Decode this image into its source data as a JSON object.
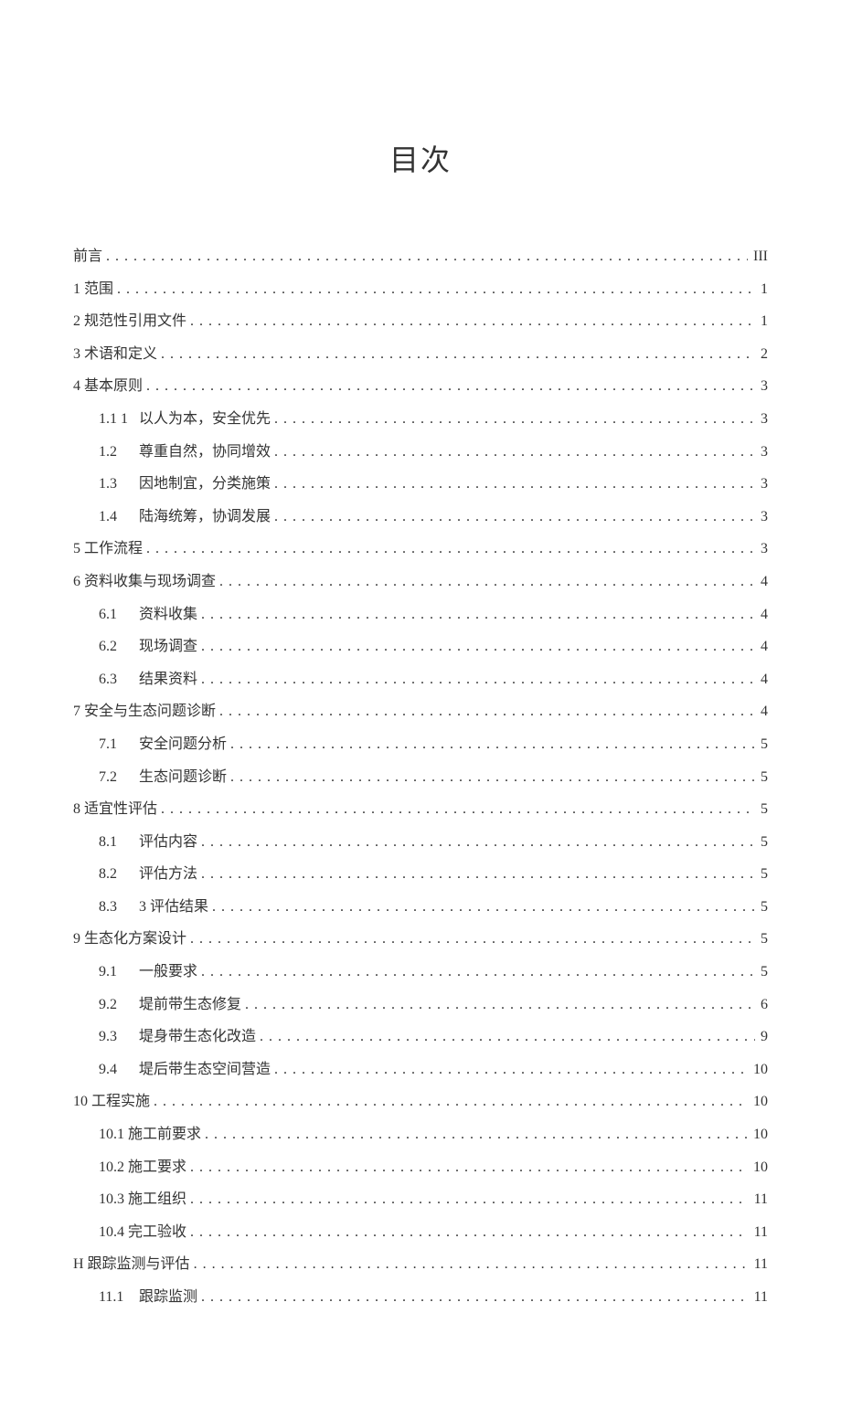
{
  "title": "目次",
  "toc": [
    {
      "indent": 0,
      "num": "",
      "label": "前言",
      "page": "III"
    },
    {
      "indent": 0,
      "num": "",
      "label": "1 范围",
      "page": "1"
    },
    {
      "indent": 0,
      "num": "",
      "label": "2 规范性引用文件",
      "page": "1"
    },
    {
      "indent": 0,
      "num": "",
      "label": "3 术语和定义",
      "page": "2"
    },
    {
      "indent": 0,
      "num": "",
      "label": "4 基本原则",
      "page": "3"
    },
    {
      "indent": 1,
      "num": "1.1 1",
      "label": "以人为本，安全优先",
      "page": "3"
    },
    {
      "indent": 1,
      "num": "1.2",
      "label": "尊重自然，协同增效",
      "page": "3"
    },
    {
      "indent": 1,
      "num": "1.3",
      "label": "因地制宜，分类施策",
      "page": "3"
    },
    {
      "indent": 1,
      "num": "1.4",
      "label": "陆海统筹，协调发展",
      "page": "3"
    },
    {
      "indent": 0,
      "num": "",
      "label": "5 工作流程",
      "page": "3"
    },
    {
      "indent": 0,
      "num": "",
      "label": "6 资料收集与现场调查",
      "page": "4"
    },
    {
      "indent": 1,
      "num": "6.1",
      "label": "资料收集",
      "page": "4"
    },
    {
      "indent": 1,
      "num": "6.2",
      "label": "现场调查",
      "page": "4"
    },
    {
      "indent": 1,
      "num": "6.3",
      "label": "结果资料",
      "page": "4"
    },
    {
      "indent": 0,
      "num": "",
      "label": "7 安全与生态问题诊断",
      "page": "4"
    },
    {
      "indent": 1,
      "num": "7.1",
      "label": "安全问题分析",
      "page": "5"
    },
    {
      "indent": 1,
      "num": "7.2",
      "label": "生态问题诊断",
      "page": "5"
    },
    {
      "indent": 0,
      "num": "",
      "label": "8 适宜性评估",
      "page": "5"
    },
    {
      "indent": 1,
      "num": "8.1",
      "label": "评估内容",
      "page": "5"
    },
    {
      "indent": 1,
      "num": "8.2",
      "label": "评估方法",
      "page": "5"
    },
    {
      "indent": 1,
      "num": "8.3",
      "label": "3 评估结果",
      "page": "5"
    },
    {
      "indent": 0,
      "num": "",
      "label": "9 生态化方案设计",
      "page": "5"
    },
    {
      "indent": 1,
      "num": "9.1",
      "label": "一般要求",
      "page": "5"
    },
    {
      "indent": 1,
      "num": "9.2",
      "label": "堤前带生态修复",
      "page": "6"
    },
    {
      "indent": 1,
      "num": "9.3",
      "label": "堤身带生态化改造",
      "page": "9"
    },
    {
      "indent": 1,
      "num": "9.4",
      "label": "堤后带生态空间营造",
      "page": "10"
    },
    {
      "indent": 0,
      "num": "",
      "label": "10 工程实施",
      "page": "10"
    },
    {
      "indent": 1,
      "num": "",
      "label": "10.1 施工前要求",
      "page": "10"
    },
    {
      "indent": 1,
      "num": "",
      "label": "10.2 施工要求",
      "page": "10"
    },
    {
      "indent": 1,
      "num": "",
      "label": "10.3 施工组织",
      "page": "11"
    },
    {
      "indent": 1,
      "num": "",
      "label": "10.4 完工验收",
      "page": "11"
    },
    {
      "indent": 0,
      "num": "",
      "label": "H 跟踪监测与评估",
      "page": "11"
    },
    {
      "indent": 1,
      "num": "11.1",
      "label": "跟踪监测",
      "page": "11"
    }
  ]
}
